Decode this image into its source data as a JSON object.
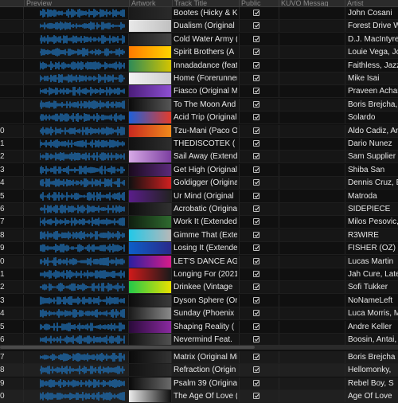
{
  "header": {
    "preview": "Preview",
    "artwork": "Artwork",
    "track_title": "Track Title",
    "public": "Public",
    "kuvo": "KUVO Messag",
    "artist": "Artist"
  },
  "rows_top": [
    {
      "num": "",
      "title": "Bootes (Hicky & K",
      "artist": "John Cosani",
      "colors": [
        "#1a1a1a",
        "#2a2a2a"
      ]
    },
    {
      "num": "",
      "title": "Dualism (Original",
      "artist": "Forest Drive W",
      "colors": [
        "#e8e8e8",
        "#c0c0c0"
      ]
    },
    {
      "num": "",
      "title": "Cold Water Army (",
      "artist": "D.J. MacIntyre,",
      "colors": [
        "#1c1c1c",
        "#444444"
      ]
    },
    {
      "num": "",
      "title": "Spirit Brothers (A",
      "artist": "Louie Vega, Jos",
      "colors": [
        "#ff7a00",
        "#ffd400"
      ]
    },
    {
      "num": "",
      "title": "Innadadance (feat",
      "artist": "Faithless, Jazz",
      "colors": [
        "#2e8b57",
        "#d4c400"
      ]
    },
    {
      "num": "",
      "title": "Home (Forerunner",
      "artist": "Mike Isai",
      "colors": [
        "#f2f2f2",
        "#cfcfcf"
      ]
    },
    {
      "num": "",
      "title": "Fiasco (Original M",
      "artist": "Praveen Achary",
      "colors": [
        "#4b1d7a",
        "#8d4fd1"
      ]
    },
    {
      "num": "",
      "title": "To The Moon And",
      "artist": "Boris Brejcha,",
      "colors": [
        "#0b0b0b",
        "#555555"
      ]
    },
    {
      "num": "",
      "title": "Acid Trip (Original",
      "artist": "Solardo",
      "colors": [
        "#1e5fd8",
        "#e23c2c"
      ]
    },
    {
      "num": "0",
      "title": "Tzu-Mani (Paco O",
      "artist": "Aldo Cadiz, And",
      "colors": [
        "#c8291f",
        "#f08a1c"
      ]
    },
    {
      "num": "1",
      "title": "THEDISCOTEK (",
      "artist": "Dario Nunez",
      "colors": [
        "#111111",
        "#2d2d2d"
      ]
    },
    {
      "num": "2",
      "title": "Sail Away (Extend",
      "artist": "Sam Supplier",
      "colors": [
        "#d7a9e6",
        "#7c3fa0"
      ]
    },
    {
      "num": "3",
      "title": "Get High (Original",
      "artist": "Shiba San",
      "colors": [
        "#1a0a1e",
        "#5a2a7a"
      ]
    },
    {
      "num": "4",
      "title": "Goldigger (Origina",
      "artist": "Dennis Cruz, E",
      "colors": [
        "#101010",
        "#d02020"
      ]
    },
    {
      "num": "5",
      "title": "Ur Mind (Original",
      "artist": "Matroda",
      "colors": [
        "#5a1d8a",
        "#222222"
      ]
    },
    {
      "num": "6",
      "title": "Acrobatic (Original",
      "artist": "SIDEPIECE",
      "colors": [
        "#0e0e0e",
        "#303030"
      ]
    },
    {
      "num": "7",
      "title": "Work It (Extended",
      "artist": "Milos Pesovic,",
      "colors": [
        "#0f1e0f",
        "#2f6a2f"
      ]
    },
    {
      "num": "8",
      "title": "Gimme That (Exte",
      "artist": "R3WIRE",
      "colors": [
        "#22c8e8",
        "#b8b8b8"
      ]
    },
    {
      "num": "9",
      "title": "Losing It (Extende",
      "artist": "FISHER (OZ)",
      "colors": [
        "#0c5fc8",
        "#2a2a8a"
      ]
    },
    {
      "num": "0",
      "title": "LET'S DANCE AG",
      "artist": "Lucas Martin",
      "colors": [
        "#2a1fa0",
        "#d81b8a"
      ]
    },
    {
      "num": "1",
      "title": "Longing For (2021",
      "artist": "Jah Cure, Late",
      "colors": [
        "#d01a1a",
        "#1a1a1a"
      ]
    },
    {
      "num": "2",
      "title": "Drinkee (Vintage",
      "artist": "Sofi Tukker",
      "colors": [
        "#22c94a",
        "#e8e000"
      ]
    },
    {
      "num": "3",
      "title": "Dyson Sphere (Ori",
      "artist": "NoNameLeft",
      "colors": [
        "#0c0c0c",
        "#3a3a3a"
      ]
    },
    {
      "num": "4",
      "title": "Sunday (Phoenix",
      "artist": "Luca Morris, M",
      "colors": [
        "#1a1a1a",
        "#8a8a8a"
      ]
    },
    {
      "num": "5",
      "title": "Shaping Reality (",
      "artist": "Andre Keller",
      "colors": [
        "#2a0a3a",
        "#8a2aa0"
      ]
    },
    {
      "num": "6",
      "title": "Nevermind Feat.",
      "artist": "Boosin, Antai, A",
      "colors": [
        "#111111",
        "#505050"
      ]
    }
  ],
  "rows_bottom": [
    {
      "num": "7",
      "title": "Matrix (Original Mi",
      "artist": "Boris Brejcha",
      "colors": [
        "#0a0a0a",
        "#333333"
      ]
    },
    {
      "num": "8",
      "title": "Refraction (Origin",
      "artist": "Hellomonky,",
      "colors": [
        "#111111",
        "#2a2a2a"
      ]
    },
    {
      "num": "9",
      "title": "Psalm 39 (Original",
      "artist": "Rebel Boy, S",
      "colors": [
        "#0a0a0a",
        "#6a6a6a"
      ]
    },
    {
      "num": "0",
      "title": "The Age Of Love (",
      "artist": "Age Of Love",
      "colors": [
        "#ececec",
        "#101010"
      ]
    }
  ]
}
